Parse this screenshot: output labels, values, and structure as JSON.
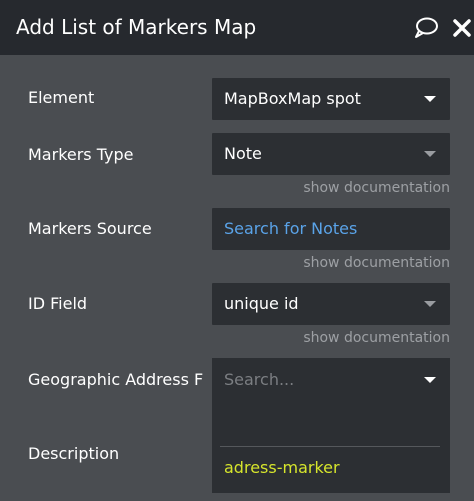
{
  "header": {
    "title": "Add List of Markers Map",
    "comment_icon": "speech-bubble-icon",
    "close_icon": "close-x-icon"
  },
  "rows": {
    "element": {
      "label": "Element",
      "value": "MapBoxMap spot"
    },
    "markers_type": {
      "label": "Markers Type",
      "value": "Note",
      "doc": "show documentation"
    },
    "markers_source": {
      "label": "Markers Source",
      "value": "Search for Notes",
      "doc": "show documentation"
    },
    "id_field": {
      "label": "ID Field",
      "value": "unique id",
      "doc": "show documentation"
    },
    "geo_address": {
      "label": "Geographic Address F"
    },
    "description": {
      "label": "Description"
    }
  },
  "dropdown": {
    "placeholder": "Search...",
    "options": [
      "adress-marker"
    ]
  },
  "colors": {
    "panel_bg": "#4a4d51",
    "header_bg": "#26292e",
    "field_bg": "#2c2f33",
    "link": "#5aa3e8",
    "option_highlight": "#d6e52c"
  }
}
